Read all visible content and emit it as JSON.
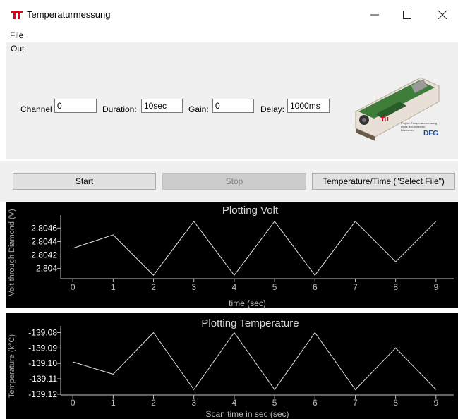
{
  "window": {
    "title": "Temperaturmessung",
    "minimize_icon": "minimize-icon",
    "maximize_icon": "maximize-icon",
    "close_icon": "close-icon"
  },
  "menu": {
    "file": "File"
  },
  "group": {
    "label": "Out"
  },
  "controls": {
    "channel_label": "Channel",
    "channel_value": "0",
    "duration_label": "Duration:",
    "duration_value": "10sec",
    "gain_label": "Gain:",
    "gain_value": "0",
    "delay_label": "Delay:",
    "delay_value": "1000ms"
  },
  "device_image": {
    "caption_lines": [
      "Projekt: Temperaturmessung",
      "eines Bor-dotierten",
      "Diamanten"
    ],
    "logo_text": "DFG"
  },
  "buttons": {
    "start": "Start",
    "stop": "Stop",
    "temp_time": "Temperature/Time (\"Select File\")"
  },
  "colors": {
    "plot_bg": "#000000",
    "plot_fg": "#ffffff",
    "axis": "#bfbfbf",
    "logo_red": "#e2001a",
    "dfg_blue": "#1a4f9c"
  },
  "chart_data": [
    {
      "type": "line",
      "title": "Plotting Volt",
      "xlabel": "time (sec)",
      "ylabel": "Volt through Diamond (V)",
      "x": [
        0,
        1,
        2,
        3,
        4,
        5,
        6,
        7,
        8,
        9
      ],
      "series": [
        {
          "values": [
            2.8043,
            2.8045,
            2.8039,
            2.8047,
            2.8039,
            2.8047,
            2.8039,
            2.8047,
            2.8041,
            2.8047
          ]
        }
      ],
      "xticks": [
        "0",
        "1",
        "2",
        "3",
        "4",
        "5",
        "6",
        "7",
        "8",
        "9"
      ],
      "yticks": [
        2.804,
        2.8042,
        2.8044,
        2.8046
      ],
      "ytick_labels": [
        "2.804",
        "2.8042",
        "2.8044",
        "2.8046"
      ],
      "xlim": [
        -0.3,
        9.3
      ],
      "ylim": [
        2.80385,
        2.80475
      ]
    },
    {
      "type": "line",
      "title": "Plotting Temperature",
      "xlabel": "Scan time in sec (sec)",
      "ylabel": "Temperature (k°C)",
      "x": [
        0,
        1,
        2,
        3,
        4,
        5,
        6,
        7,
        8,
        9
      ],
      "series": [
        {
          "values": [
            -139.099,
            -139.107,
            -139.08,
            -139.117,
            -139.08,
            -139.117,
            -139.08,
            -139.117,
            -139.09,
            -139.117
          ]
        }
      ],
      "xticks": [
        "0",
        "1",
        "2",
        "3",
        "4",
        "5",
        "6",
        "7",
        "8",
        "9"
      ],
      "yticks": [
        -139.12,
        -139.11,
        -139.1,
        -139.09,
        -139.08
      ],
      "ytick_labels": [
        "-139.12",
        "-139.11",
        "-139.10",
        "-139.09",
        "-139.08"
      ],
      "xlim": [
        -0.3,
        9.3
      ],
      "ylim": [
        -139.1205,
        -139.0775
      ]
    }
  ]
}
